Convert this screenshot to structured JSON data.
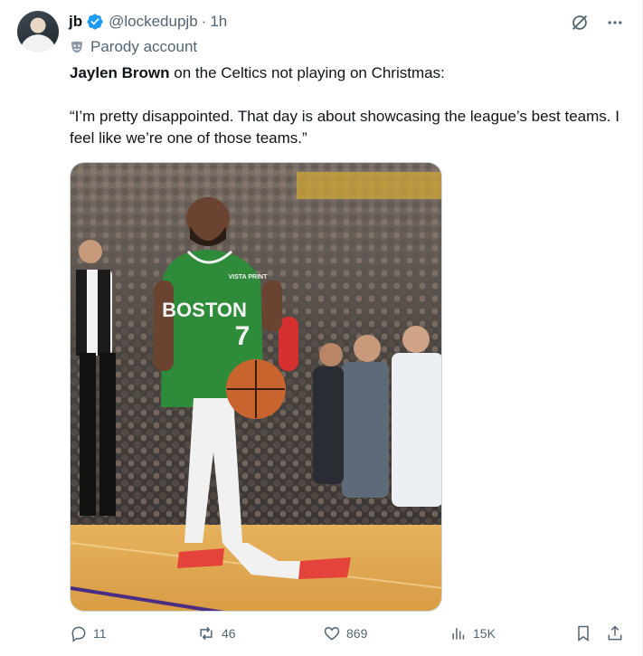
{
  "author": {
    "name": "jb",
    "handle": "@lockedupjb",
    "separator": "·",
    "time": "1h",
    "label": "Parody account"
  },
  "tweet": {
    "bold_name": "Jaylen Brown",
    "line1_rest": " on the Celtics not playing on Christmas:",
    "quote": "“I’m pretty disappointed. That day is about showcasing the league’s best teams. I feel like we’re one of those teams.”"
  },
  "media": {
    "jersey_team": "BOSTON",
    "jersey_number": "7",
    "jersey_sponsor": "VISTA PRINT"
  },
  "actions": {
    "replies": "11",
    "reposts": "46",
    "likes": "869",
    "views": "15K"
  },
  "colors": {
    "verified": "#1d9bf0",
    "secondary_text": "#536471",
    "jersey_green": "#2e8b3a"
  },
  "icons": {
    "verified": "verified-badge-icon",
    "parody": "parody-mask-icon",
    "grok": "grok-icon",
    "more": "more-icon",
    "reply": "reply-icon",
    "repost": "repost-icon",
    "like": "like-icon",
    "views": "views-icon",
    "bookmark": "bookmark-icon",
    "share": "share-icon"
  }
}
